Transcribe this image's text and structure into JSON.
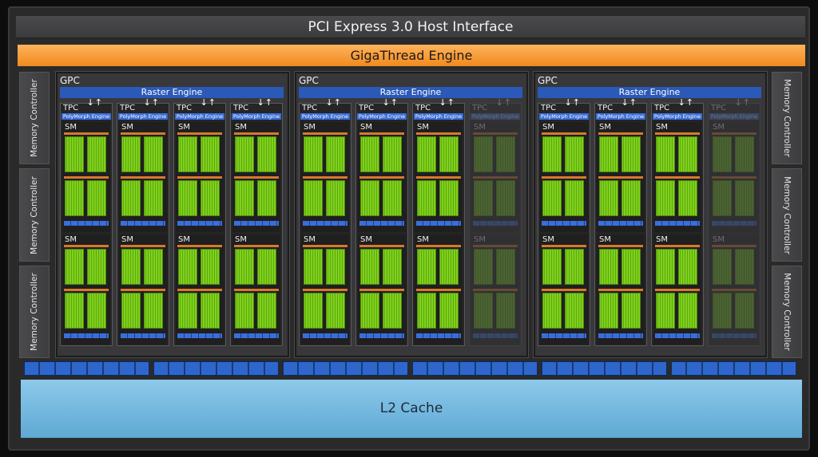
{
  "header": {
    "pcie_label": "PCI Express 3.0 Host Interface"
  },
  "scheduler": {
    "giga_label": "GigaThread Engine"
  },
  "memory_controller_label": "Memory Controller",
  "gpc": {
    "label": "GPC",
    "raster_label": "Raster Engine",
    "tpc_label": "TPC",
    "polymorph_label": "PolyMorph Engine",
    "sm_label": "SM",
    "count": 3,
    "tpcs_per_gpc": 4,
    "enabled_tpcs_per_gpc": [
      4,
      3,
      3
    ]
  },
  "cache": {
    "l2_label": "L2 Cache"
  },
  "colors": {
    "giga": "#f08a1e",
    "raster": "#2b59b8",
    "core_green": "#7fd11b",
    "l2": "#6fb4dc"
  }
}
